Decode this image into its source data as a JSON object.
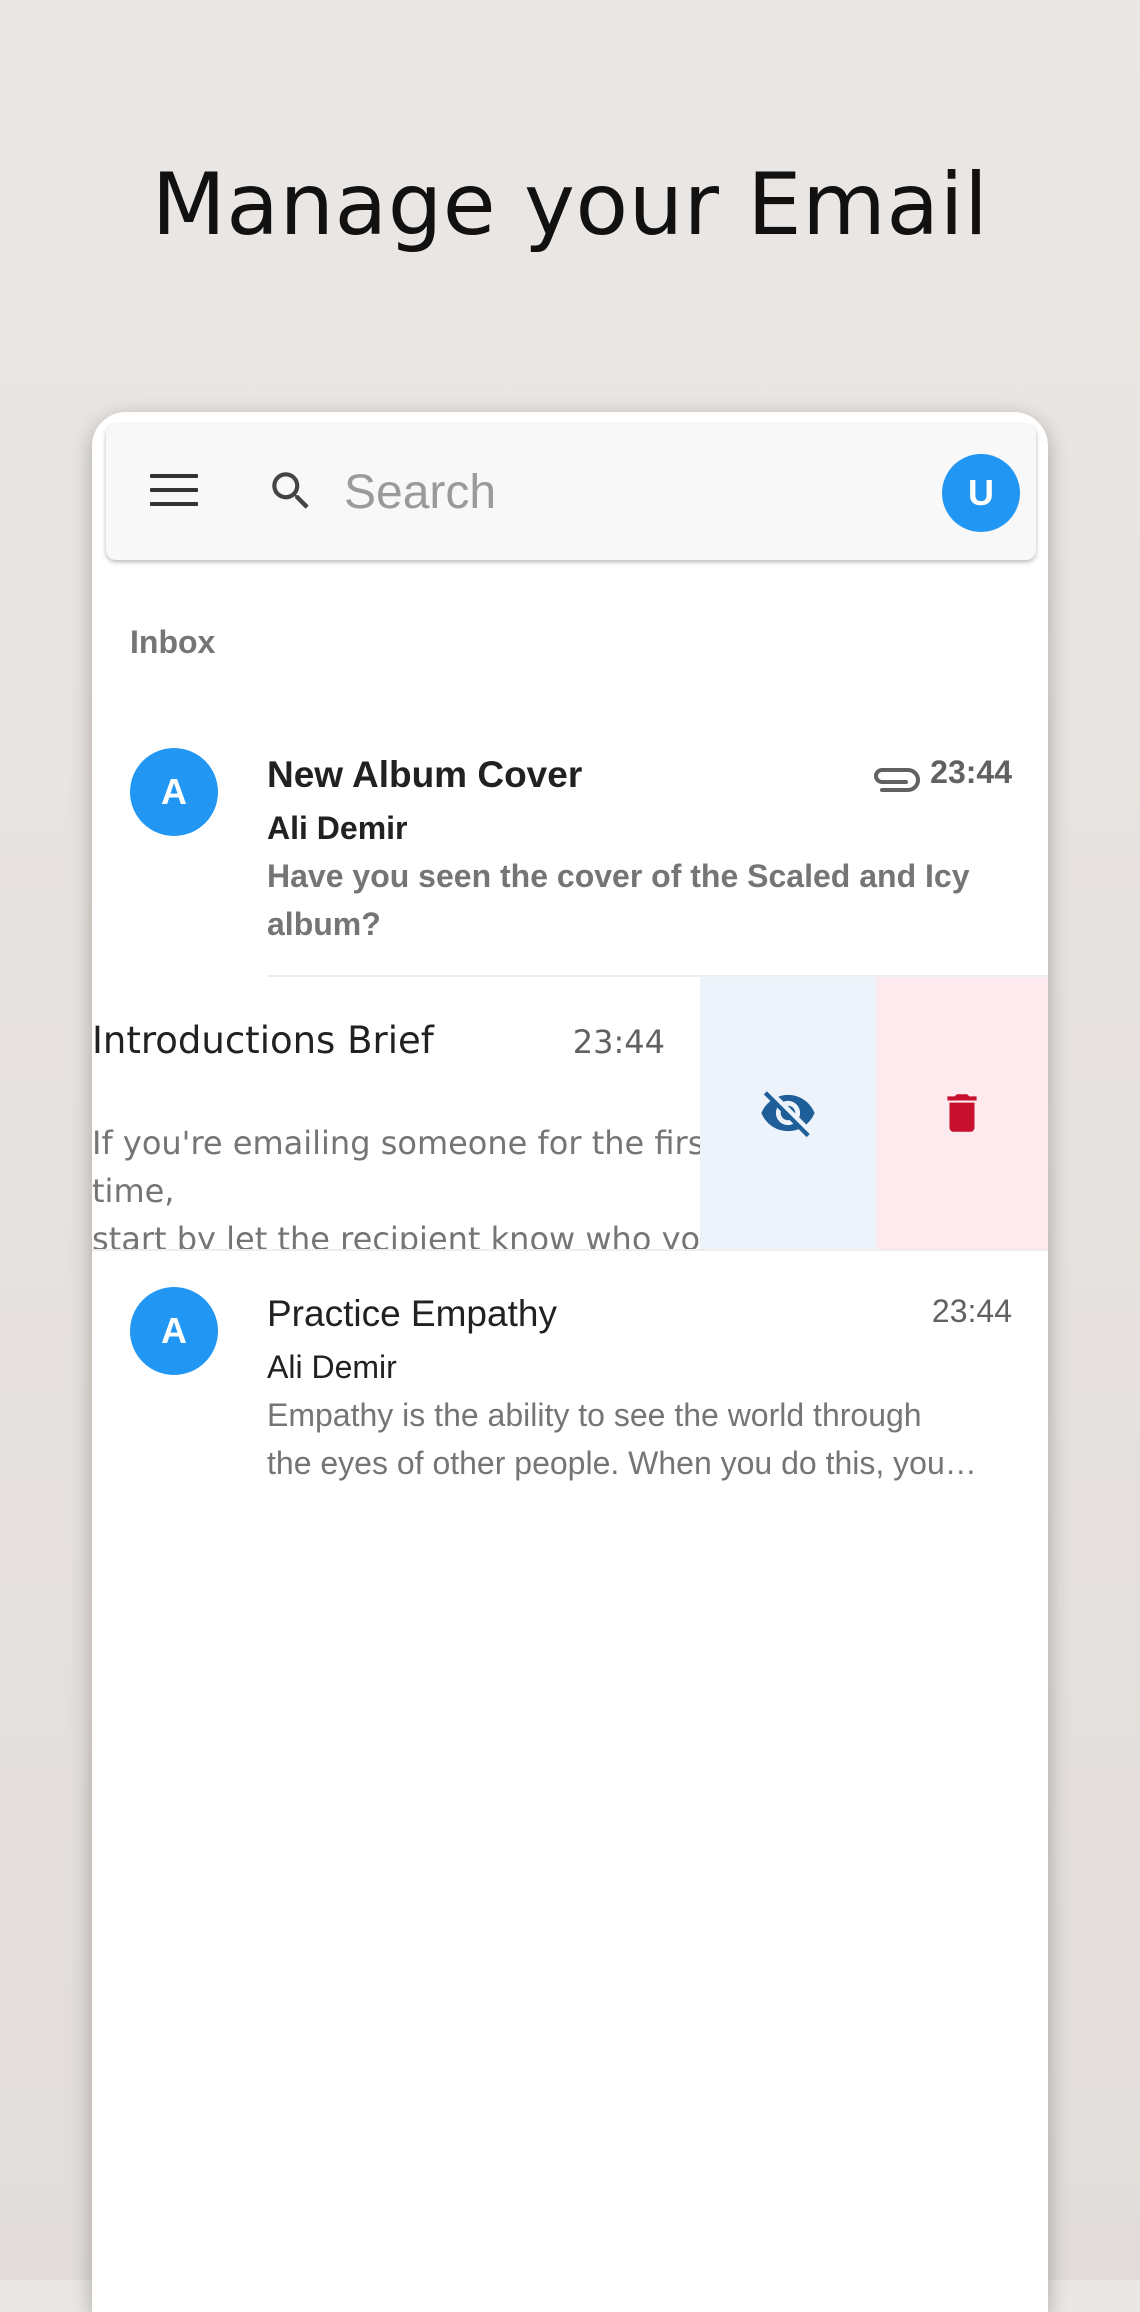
{
  "headline": "Manage your Email",
  "search": {
    "placeholder": "Search",
    "user_initial": "U"
  },
  "section_label": "Inbox",
  "emails": [
    {
      "initial": "A",
      "subject": "New Album Cover",
      "sender": "Ali Demir",
      "preview_line1": "Have you seen the cover of the Scaled and Icy",
      "preview_line2": "album?",
      "time": "23:44",
      "unread": true,
      "has_attachment": true
    },
    {
      "subject_visible": "ductions Brief",
      "preview_line1": "e emailing someone for the first time,",
      "preview_line2": " let the recipient know who you are....",
      "time": "23:44",
      "swiped": true,
      "actions": [
        "eye-off-icon",
        "trash-icon"
      ]
    },
    {
      "initial": "A",
      "subject": "Practice Empathy",
      "sender": "Ali Demir",
      "preview_line1": "Empathy is the ability to see the world through",
      "preview_line2": "the eyes of other people. When you do this, you…",
      "time": "23:44",
      "unread": false,
      "has_attachment": false
    }
  ],
  "colors": {
    "accent": "#2196f3",
    "hide_action_bg": "#edf3fb",
    "hide_action_icon": "#1f5f99",
    "delete_action_bg": "#fdeaee",
    "delete_action_icon": "#c8102e"
  }
}
